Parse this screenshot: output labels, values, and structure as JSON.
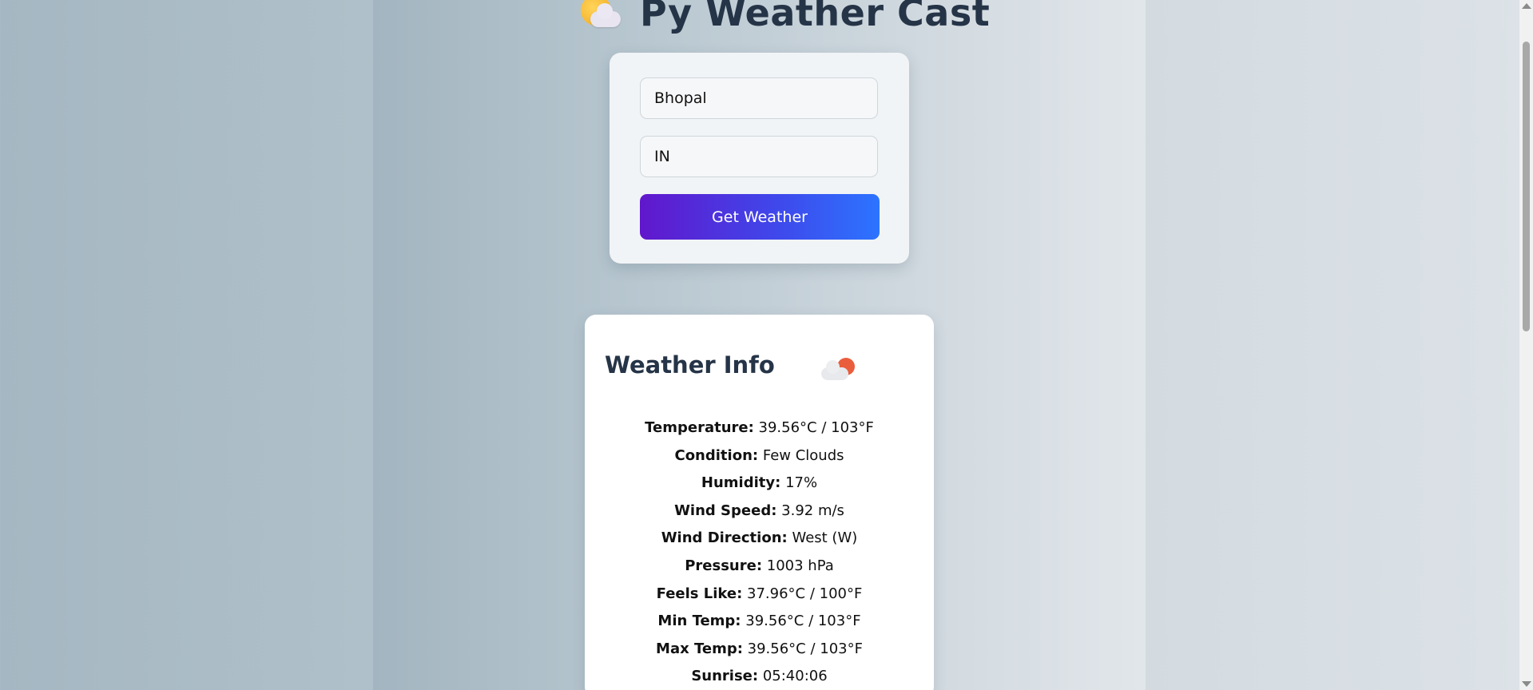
{
  "app": {
    "title": "Py Weather Cast",
    "title_icon": "sun-behind-cloud-icon"
  },
  "form": {
    "city_value": "Bhopal",
    "country_value": "IN",
    "submit_label": "Get Weather"
  },
  "info": {
    "heading": "Weather Info",
    "condition_icon": "few-clouds-icon",
    "rows": [
      {
        "label": "Temperature:",
        "value": "39.56°C / 103°F"
      },
      {
        "label": "Condition:",
        "value": "Few Clouds"
      },
      {
        "label": "Humidity:",
        "value": "17%"
      },
      {
        "label": "Wind Speed:",
        "value": "3.92 m/s"
      },
      {
        "label": "Wind Direction:",
        "value": "West (W)"
      },
      {
        "label": "Pressure:",
        "value": "1003 hPa"
      },
      {
        "label": "Feels Like:",
        "value": "37.96°C / 100°F"
      },
      {
        "label": "Min Temp:",
        "value": "39.56°C / 103°F"
      },
      {
        "label": "Max Temp:",
        "value": "39.56°C / 103°F"
      },
      {
        "label": "Sunrise:",
        "value": "05:40:06"
      }
    ]
  },
  "colors": {
    "accent_start": "#6117cc",
    "accent_end": "#2c74ff",
    "title_text": "#253447",
    "condition_icon_sun": "#ea5d3c"
  }
}
